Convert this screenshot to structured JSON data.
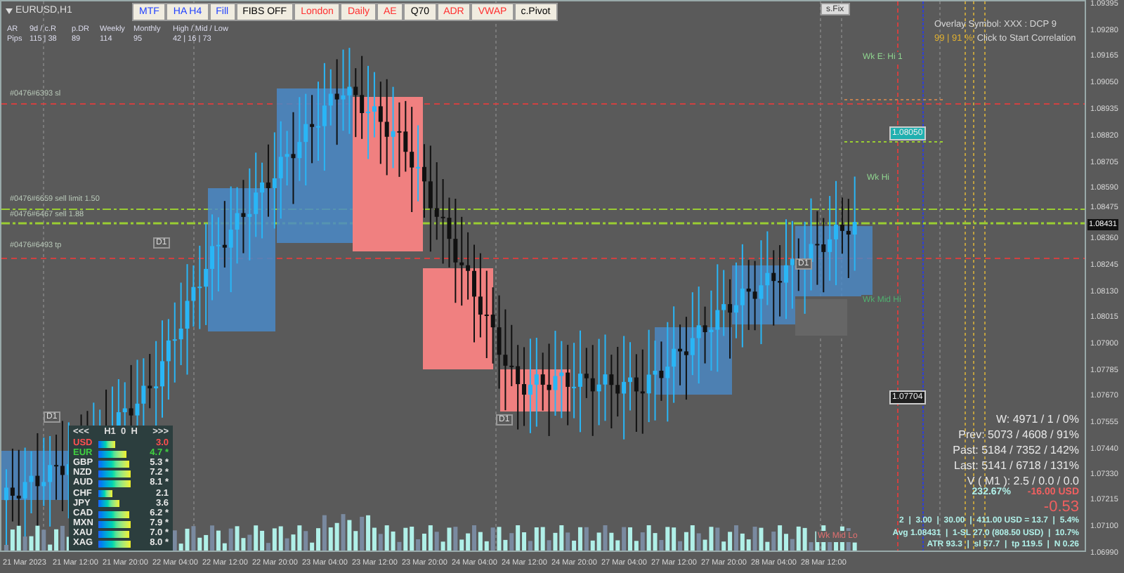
{
  "symbol": "EURUSD,H1",
  "toolbar": [
    {
      "label": "MTF",
      "color": "#2040ff"
    },
    {
      "label": "HA H4",
      "color": "#2040ff"
    },
    {
      "label": "Fill",
      "color": "#2040ff"
    },
    {
      "label": "FIBS OFF",
      "color": "#000000"
    },
    {
      "label": "London",
      "color": "#ff3030"
    },
    {
      "label": "Daily",
      "color": "#ff3030"
    },
    {
      "label": "AE",
      "color": "#ff3030"
    },
    {
      "label": "Q70",
      "color": "#000000"
    },
    {
      "label": "ADR",
      "color": "#ff3030"
    },
    {
      "label": "VWAP",
      "color": "#ff3030"
    },
    {
      "label": "c.Pivot",
      "color": "#000000"
    }
  ],
  "fix_button": "s.Fix",
  "range_stats": {
    "headers": [
      "AR",
      "9d / c.R",
      "p.DR",
      "Weekly",
      "Monthly",
      "High / Mid / Low"
    ],
    "values": [
      "Pips",
      "115 | 38",
      "89",
      "114",
      "95",
      "42 | 16 | 73"
    ]
  },
  "order_labels": [
    "#0476#6393 sl",
    "#0476#6659 sell limit 1.50",
    "#0476#6467 sell 1.88",
    "#0476#6493 tp"
  ],
  "period_labels": [
    "D1",
    "D1",
    "D1",
    "D1"
  ],
  "overlay": {
    "line1": "Overlay Symbol: XXX : DCP 9",
    "correlation": "99 | 91 %",
    "action": "Click to Start Correlation"
  },
  "weekly_labels": [
    "Wk E: Hi 1",
    "Wk Hi",
    "Wk Mid Hi",
    "Wk Mid Lo"
  ],
  "price_tags": [
    "1.08050",
    "1.07704"
  ],
  "stats": [
    "W: 4971 / 1 / 0%",
    "Prev: 5073 / 4608 / 91%",
    "Past: 5184 / 7352 / 142%",
    "Last: 5141 / 6718 / 131%",
    "V ( M1 ): 2.5 / 0.0 / 0.0"
  ],
  "profit": {
    "percent": "232.67%",
    "amount": "-16.00 USD",
    "value": "-0.53"
  },
  "summary": [
    "2  |  3.00  |  30.00  |  411.00 USD = 13.7  |  5.4%",
    "Avg 1.08431  |  1-SL 27.0 (808.50 USD)  |  10.7%",
    "ATR 93.3  |  sl 57.7  |  tp 119.5  |  N 0.26"
  ],
  "strength_panel": {
    "prev": "<<<",
    "title": "H1  0  H",
    "next": ">>>",
    "rows": [
      {
        "currency": "USD",
        "value": "3.0",
        "color": "#ff5050"
      },
      {
        "currency": "EUR",
        "value": "4.7 *",
        "color": "#40d040"
      },
      {
        "currency": "GBP",
        "value": "5.3 *",
        "color": "#e8e8e8"
      },
      {
        "currency": "NZD",
        "value": "7.2 *",
        "color": "#e8e8e8"
      },
      {
        "currency": "AUD",
        "value": "8.1 *",
        "color": "#e8e8e8"
      },
      {
        "currency": "CHF",
        "value": "2.1",
        "color": "#e8e8e8"
      },
      {
        "currency": "JPY",
        "value": "3.6",
        "color": "#e8e8e8"
      },
      {
        "currency": "CAD",
        "value": "6.2 *",
        "color": "#e8e8e8"
      },
      {
        "currency": "MXN",
        "value": "7.9 *",
        "color": "#e8e8e8"
      },
      {
        "currency": "XAU",
        "value": "7.0 *",
        "color": "#e8e8e8"
      },
      {
        "currency": "XAG",
        "value": "8.0 *",
        "color": "#e8e8e8"
      }
    ]
  },
  "price_axis": [
    "1.09395",
    "1.09280",
    "1.09165",
    "1.09050",
    "1.08935",
    "1.08820",
    "1.08705",
    "1.08590",
    "1.08475",
    "1.08360",
    "1.08245",
    "1.08130",
    "1.08015",
    "1.07900",
    "1.07785",
    "1.07670",
    "1.07555",
    "1.07440",
    "1.07330",
    "1.07215",
    "1.07100",
    "1.06990"
  ],
  "current_price": "1.08431",
  "time_axis": [
    "21 Mar 2023",
    "21 Mar 12:00",
    "21 Mar 20:00",
    "22 Mar 04:00",
    "22 Mar 12:00",
    "22 Mar 20:00",
    "23 Mar 04:00",
    "23 Mar 12:00",
    "23 Mar 20:00",
    "24 Mar 04:00",
    "24 Mar 12:00",
    "24 Mar 20:00",
    "27 Mar 04:00",
    "27 Mar 12:00",
    "27 Mar 20:00",
    "28 Mar 04:00",
    "28 Mar 12:00"
  ]
}
